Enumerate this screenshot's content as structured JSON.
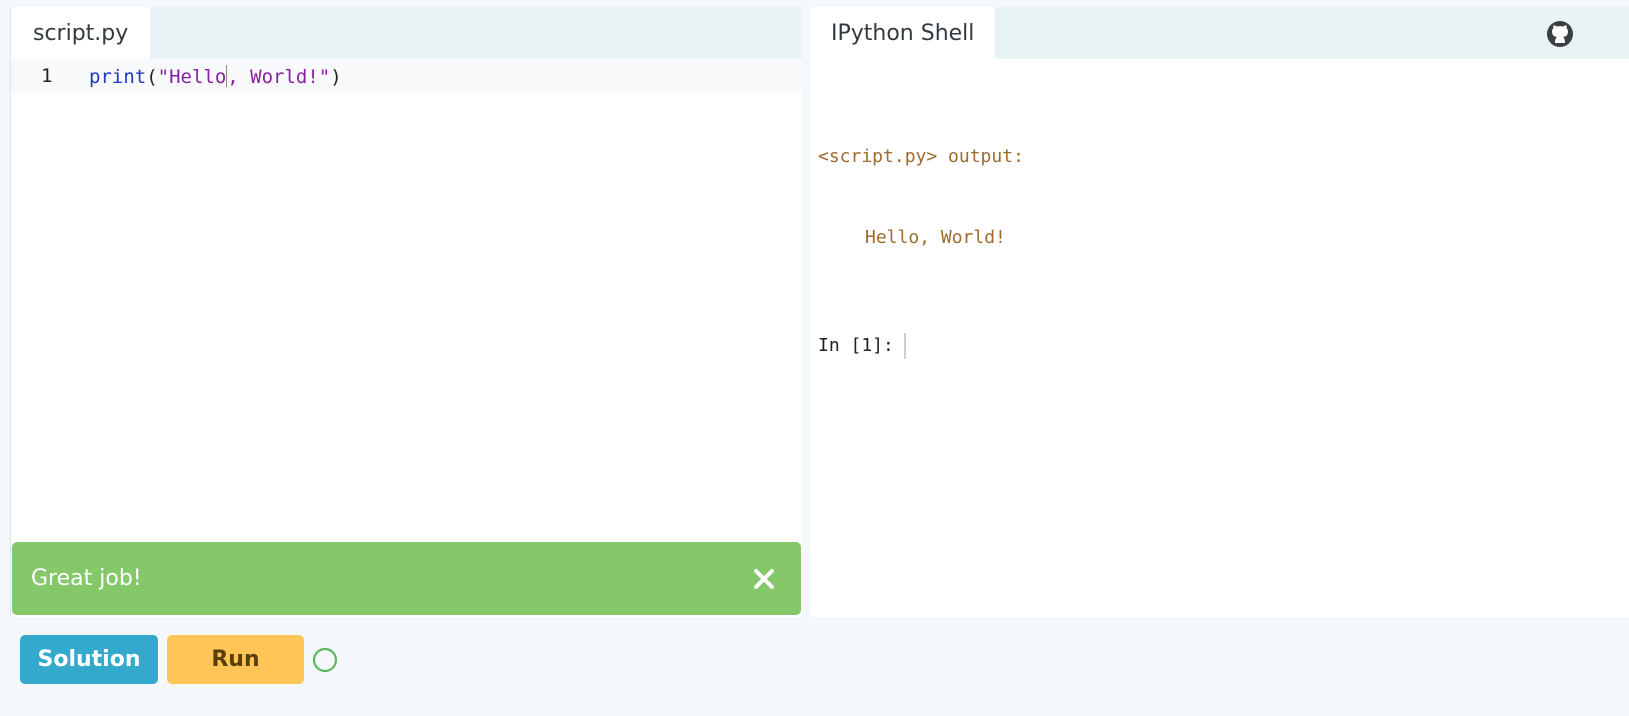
{
  "editor": {
    "tab_label": "script.py",
    "line_number": "1",
    "code": {
      "func": "print",
      "open_paren": "(",
      "string_before_cursor": "\"Hello",
      "string_after_cursor": ", World!\"",
      "close_paren": ")"
    }
  },
  "toast": {
    "message": "Great job!",
    "close_icon": "close-icon"
  },
  "shell": {
    "tab_label": "IPython Shell",
    "output_header": "<script.py> output:",
    "output_line": "Hello, World!",
    "prompt": "In [1]:",
    "icon": "github-icon"
  },
  "controls": {
    "solution_label": "Solution",
    "run_label": "Run",
    "status_icon": "status-circle-icon"
  },
  "colors": {
    "toast_bg": "#84c869",
    "solution_bg": "#33aacc",
    "run_bg": "#ffc556",
    "status_green": "#5cb85c",
    "string_color": "#8a1fa3",
    "func_color": "#1f35c4",
    "output_color": "#a06a2c"
  }
}
